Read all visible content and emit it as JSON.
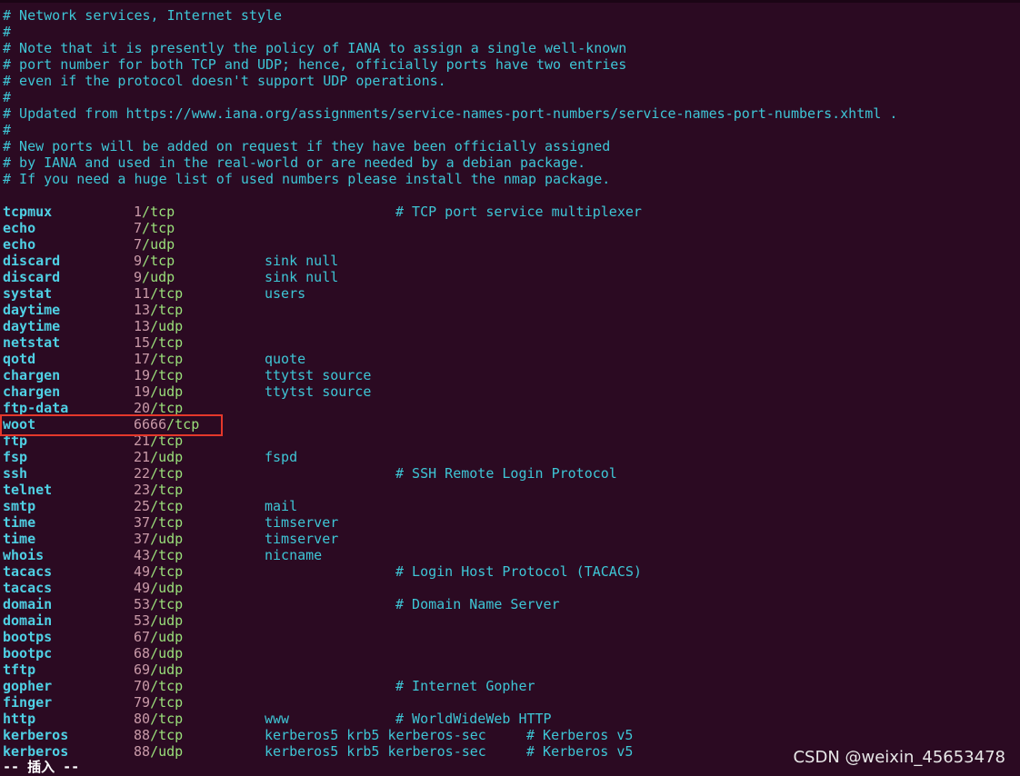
{
  "header_comments": [
    "# Network services, Internet style",
    "#",
    "# Note that it is presently the policy of IANA to assign a single well-known",
    "# port number for both TCP and UDP; hence, officially ports have two entries",
    "# even if the protocol doesn't support UDP operations.",
    "#",
    "# Updated from https://www.iana.org/assignments/service-names-port-numbers/service-names-port-numbers.xhtml .",
    "#",
    "# New ports will be added on request if they have been officially assigned",
    "# by IANA and used in the real-world or are needed by a debian package.",
    "# If you need a huge list of used numbers please install the nmap package."
  ],
  "entries": [
    {
      "name": "tcpmux",
      "port": "1",
      "proto": "tcp",
      "alias": "",
      "comment": "# TCP port service multiplexer"
    },
    {
      "name": "echo",
      "port": "7",
      "proto": "tcp",
      "alias": "",
      "comment": ""
    },
    {
      "name": "echo",
      "port": "7",
      "proto": "udp",
      "alias": "",
      "comment": ""
    },
    {
      "name": "discard",
      "port": "9",
      "proto": "tcp",
      "alias": "sink null",
      "comment": ""
    },
    {
      "name": "discard",
      "port": "9",
      "proto": "udp",
      "alias": "sink null",
      "comment": ""
    },
    {
      "name": "systat",
      "port": "11",
      "proto": "tcp",
      "alias": "users",
      "comment": ""
    },
    {
      "name": "daytime",
      "port": "13",
      "proto": "tcp",
      "alias": "",
      "comment": ""
    },
    {
      "name": "daytime",
      "port": "13",
      "proto": "udp",
      "alias": "",
      "comment": ""
    },
    {
      "name": "netstat",
      "port": "15",
      "proto": "tcp",
      "alias": "",
      "comment": ""
    },
    {
      "name": "qotd",
      "port": "17",
      "proto": "tcp",
      "alias": "quote",
      "comment": ""
    },
    {
      "name": "chargen",
      "port": "19",
      "proto": "tcp",
      "alias": "ttytst source",
      "comment": ""
    },
    {
      "name": "chargen",
      "port": "19",
      "proto": "udp",
      "alias": "ttytst source",
      "comment": ""
    },
    {
      "name": "ftp-data",
      "port": "20",
      "proto": "tcp",
      "alias": "",
      "comment": ""
    },
    {
      "name": "woot",
      "port": "6666",
      "proto": "tcp",
      "alias": "",
      "comment": ""
    },
    {
      "name": "ftp",
      "port": "21",
      "proto": "tcp",
      "alias": "",
      "comment": ""
    },
    {
      "name": "fsp",
      "port": "21",
      "proto": "udp",
      "alias": "fspd",
      "comment": ""
    },
    {
      "name": "ssh",
      "port": "22",
      "proto": "tcp",
      "alias": "",
      "comment": "# SSH Remote Login Protocol"
    },
    {
      "name": "telnet",
      "port": "23",
      "proto": "tcp",
      "alias": "",
      "comment": ""
    },
    {
      "name": "smtp",
      "port": "25",
      "proto": "tcp",
      "alias": "mail",
      "comment": ""
    },
    {
      "name": "time",
      "port": "37",
      "proto": "tcp",
      "alias": "timserver",
      "comment": ""
    },
    {
      "name": "time",
      "port": "37",
      "proto": "udp",
      "alias": "timserver",
      "comment": ""
    },
    {
      "name": "whois",
      "port": "43",
      "proto": "tcp",
      "alias": "nicname",
      "comment": ""
    },
    {
      "name": "tacacs",
      "port": "49",
      "proto": "tcp",
      "alias": "",
      "comment": "# Login Host Protocol (TACACS)"
    },
    {
      "name": "tacacs",
      "port": "49",
      "proto": "udp",
      "alias": "",
      "comment": ""
    },
    {
      "name": "domain",
      "port": "53",
      "proto": "tcp",
      "alias": "",
      "comment": "# Domain Name Server"
    },
    {
      "name": "domain",
      "port": "53",
      "proto": "udp",
      "alias": "",
      "comment": ""
    },
    {
      "name": "bootps",
      "port": "67",
      "proto": "udp",
      "alias": "",
      "comment": ""
    },
    {
      "name": "bootpc",
      "port": "68",
      "proto": "udp",
      "alias": "",
      "comment": ""
    },
    {
      "name": "tftp",
      "port": "69",
      "proto": "udp",
      "alias": "",
      "comment": ""
    },
    {
      "name": "gopher",
      "port": "70",
      "proto": "tcp",
      "alias": "",
      "comment": "# Internet Gopher"
    },
    {
      "name": "finger",
      "port": "79",
      "proto": "tcp",
      "alias": "",
      "comment": ""
    },
    {
      "name": "http",
      "port": "80",
      "proto": "tcp",
      "alias": "www",
      "comment": "# WorldWideWeb HTTP"
    },
    {
      "name": "kerberos",
      "port": "88",
      "proto": "tcp",
      "alias": "kerberos5 krb5 kerberos-sec",
      "comment": "# Kerberos v5"
    },
    {
      "name": "kerberos",
      "port": "88",
      "proto": "udp",
      "alias": "kerberos5 krb5 kerberos-sec",
      "comment": "# Kerberos v5"
    }
  ],
  "status_line": "-- 插入 --",
  "watermark": "CSDN @weixin_45653478",
  "highlight_color": "#e5382b"
}
